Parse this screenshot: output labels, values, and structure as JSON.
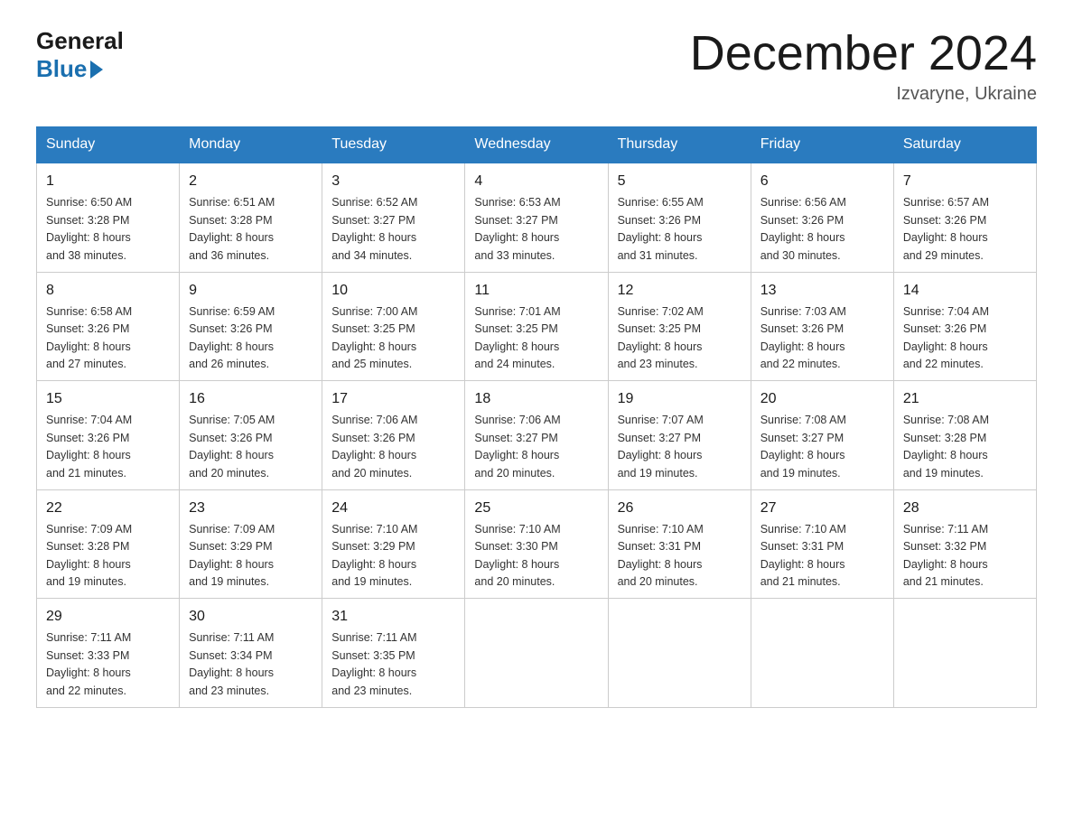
{
  "header": {
    "logo_general": "General",
    "logo_blue": "Blue",
    "month_title": "December 2024",
    "subtitle": "Izvaryne, Ukraine"
  },
  "days_of_week": [
    "Sunday",
    "Monday",
    "Tuesday",
    "Wednesday",
    "Thursday",
    "Friday",
    "Saturday"
  ],
  "weeks": [
    [
      {
        "day": "1",
        "sunrise": "6:50 AM",
        "sunset": "3:28 PM",
        "daylight": "8 hours and 38 minutes."
      },
      {
        "day": "2",
        "sunrise": "6:51 AM",
        "sunset": "3:28 PM",
        "daylight": "8 hours and 36 minutes."
      },
      {
        "day": "3",
        "sunrise": "6:52 AM",
        "sunset": "3:27 PM",
        "daylight": "8 hours and 34 minutes."
      },
      {
        "day": "4",
        "sunrise": "6:53 AM",
        "sunset": "3:27 PM",
        "daylight": "8 hours and 33 minutes."
      },
      {
        "day": "5",
        "sunrise": "6:55 AM",
        "sunset": "3:26 PM",
        "daylight": "8 hours and 31 minutes."
      },
      {
        "day": "6",
        "sunrise": "6:56 AM",
        "sunset": "3:26 PM",
        "daylight": "8 hours and 30 minutes."
      },
      {
        "day": "7",
        "sunrise": "6:57 AM",
        "sunset": "3:26 PM",
        "daylight": "8 hours and 29 minutes."
      }
    ],
    [
      {
        "day": "8",
        "sunrise": "6:58 AM",
        "sunset": "3:26 PM",
        "daylight": "8 hours and 27 minutes."
      },
      {
        "day": "9",
        "sunrise": "6:59 AM",
        "sunset": "3:26 PM",
        "daylight": "8 hours and 26 minutes."
      },
      {
        "day": "10",
        "sunrise": "7:00 AM",
        "sunset": "3:25 PM",
        "daylight": "8 hours and 25 minutes."
      },
      {
        "day": "11",
        "sunrise": "7:01 AM",
        "sunset": "3:25 PM",
        "daylight": "8 hours and 24 minutes."
      },
      {
        "day": "12",
        "sunrise": "7:02 AM",
        "sunset": "3:25 PM",
        "daylight": "8 hours and 23 minutes."
      },
      {
        "day": "13",
        "sunrise": "7:03 AM",
        "sunset": "3:26 PM",
        "daylight": "8 hours and 22 minutes."
      },
      {
        "day": "14",
        "sunrise": "7:04 AM",
        "sunset": "3:26 PM",
        "daylight": "8 hours and 22 minutes."
      }
    ],
    [
      {
        "day": "15",
        "sunrise": "7:04 AM",
        "sunset": "3:26 PM",
        "daylight": "8 hours and 21 minutes."
      },
      {
        "day": "16",
        "sunrise": "7:05 AM",
        "sunset": "3:26 PM",
        "daylight": "8 hours and 20 minutes."
      },
      {
        "day": "17",
        "sunrise": "7:06 AM",
        "sunset": "3:26 PM",
        "daylight": "8 hours and 20 minutes."
      },
      {
        "day": "18",
        "sunrise": "7:06 AM",
        "sunset": "3:27 PM",
        "daylight": "8 hours and 20 minutes."
      },
      {
        "day": "19",
        "sunrise": "7:07 AM",
        "sunset": "3:27 PM",
        "daylight": "8 hours and 19 minutes."
      },
      {
        "day": "20",
        "sunrise": "7:08 AM",
        "sunset": "3:27 PM",
        "daylight": "8 hours and 19 minutes."
      },
      {
        "day": "21",
        "sunrise": "7:08 AM",
        "sunset": "3:28 PM",
        "daylight": "8 hours and 19 minutes."
      }
    ],
    [
      {
        "day": "22",
        "sunrise": "7:09 AM",
        "sunset": "3:28 PM",
        "daylight": "8 hours and 19 minutes."
      },
      {
        "day": "23",
        "sunrise": "7:09 AM",
        "sunset": "3:29 PM",
        "daylight": "8 hours and 19 minutes."
      },
      {
        "day": "24",
        "sunrise": "7:10 AM",
        "sunset": "3:29 PM",
        "daylight": "8 hours and 19 minutes."
      },
      {
        "day": "25",
        "sunrise": "7:10 AM",
        "sunset": "3:30 PM",
        "daylight": "8 hours and 20 minutes."
      },
      {
        "day": "26",
        "sunrise": "7:10 AM",
        "sunset": "3:31 PM",
        "daylight": "8 hours and 20 minutes."
      },
      {
        "day": "27",
        "sunrise": "7:10 AM",
        "sunset": "3:31 PM",
        "daylight": "8 hours and 21 minutes."
      },
      {
        "day": "28",
        "sunrise": "7:11 AM",
        "sunset": "3:32 PM",
        "daylight": "8 hours and 21 minutes."
      }
    ],
    [
      {
        "day": "29",
        "sunrise": "7:11 AM",
        "sunset": "3:33 PM",
        "daylight": "8 hours and 22 minutes."
      },
      {
        "day": "30",
        "sunrise": "7:11 AM",
        "sunset": "3:34 PM",
        "daylight": "8 hours and 23 minutes."
      },
      {
        "day": "31",
        "sunrise": "7:11 AM",
        "sunset": "3:35 PM",
        "daylight": "8 hours and 23 minutes."
      },
      null,
      null,
      null,
      null
    ]
  ],
  "labels": {
    "sunrise": "Sunrise: ",
    "sunset": "Sunset: ",
    "daylight": "Daylight: "
  }
}
